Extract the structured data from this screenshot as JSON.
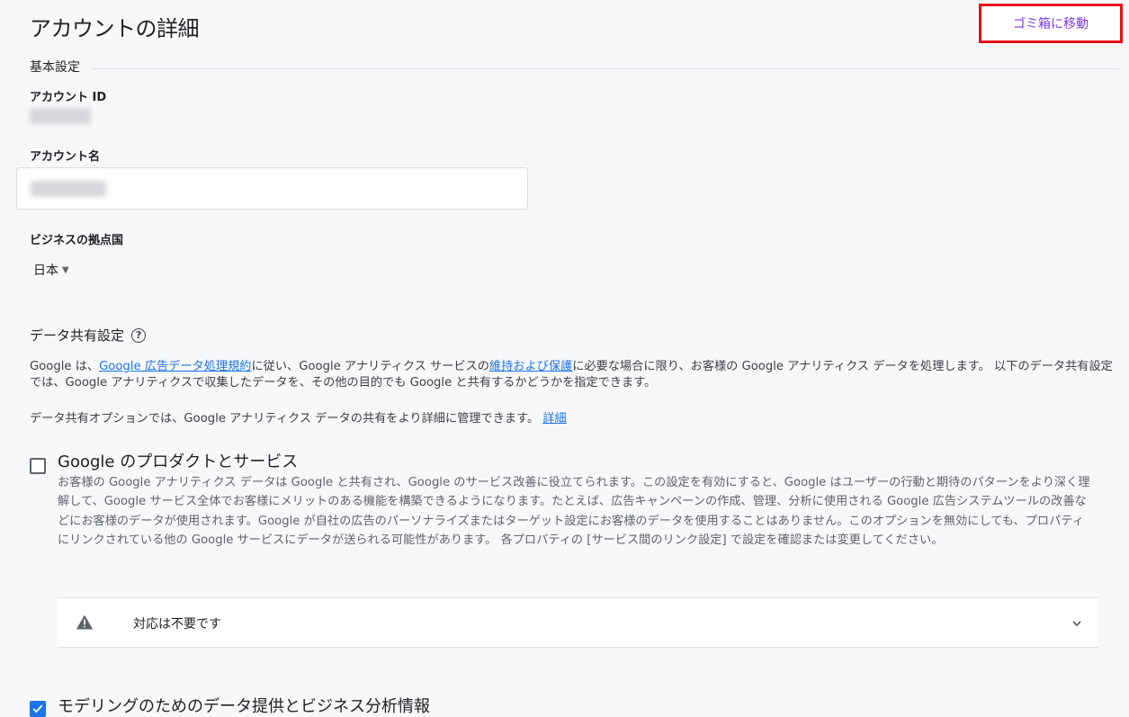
{
  "header": {
    "title": "アカウントの詳細",
    "trash_button": "ゴミ箱に移動"
  },
  "basic": {
    "section_label": "基本設定",
    "account_id_label": "アカウント ID",
    "account_name_label": "アカウント名",
    "country_label": "ビジネスの拠点国",
    "country_value": "日本"
  },
  "sharing": {
    "title": "データ共有設定",
    "p1_a": "Google は、",
    "p1_link1": "Google 広告データ処理規約",
    "p1_b": "に従い、Google アナリティクス サービスの",
    "p1_link2": "維持および保護",
    "p1_c": "に必要な場合に限り、お客様の Google アナリティクス データを処理します。 以下のデータ共有設定では、Google アナリティクスで収集したデータを、その他の目的でも Google と共有するかどうかを指定できます。",
    "p2_text": "データ共有オプションでは、Google アナリティクス データの共有をより詳細に管理できます。",
    "p2_link": "詳細"
  },
  "option_products": {
    "title": "Google のプロダクトとサービス",
    "checked": false,
    "description": "お客様の Google アナリティクス データは Google と共有され、Google のサービス改善に役立てられます。この設定を有効にすると、Google はユーザーの行動と期待のパターンをより深く理解して、Google サービス全体でお客様にメリットのある機能を構築できるようになります。たとえば、広告キャンペーンの作成、管理、分析に使用される Google 広告システムツールの改善などにお客様のデータが使用されます。Google が自社の広告のパーソナライズまたはターゲット設定にお客様のデータを使用することはありません。このオプションを無効にしても、プロパティにリンクされている他の Google サービスにデータが送られる可能性があります。 各プロパティの [サービス間のリンク設定] で設定を確認または変更してください。",
    "status_text": "対応は不要です"
  },
  "option_modeling": {
    "title": "モデリングのためのデータ提供とビジネス分析情報",
    "checked": true
  },
  "icons": {
    "help": "help-circle-icon",
    "warning": "warning-triangle-icon",
    "expand": "chevron-down-icon",
    "dropdown": "caret-down-icon",
    "check": "checkmark-icon"
  },
  "colors": {
    "link": "#1a73e8",
    "trash_text": "#7c3aed",
    "highlight_border": "#e8111c"
  }
}
